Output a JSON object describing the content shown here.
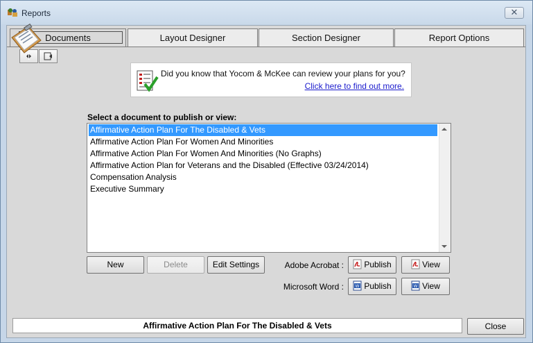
{
  "window": {
    "title": "Reports"
  },
  "tabs": [
    {
      "label": "Documents",
      "active": true
    },
    {
      "label": "Layout Designer",
      "active": false
    },
    {
      "label": "Section Designer",
      "active": false
    },
    {
      "label": "Report Options",
      "active": false
    }
  ],
  "info": {
    "text": "Did you know that Yocom & McKee can review your plans for you?",
    "link": "Click here to find out more."
  },
  "documents": {
    "label": "Select a document to publish or view:",
    "items": [
      "Affirmative Action Plan For The Disabled & Vets",
      "Affirmative Action Plan For Women And Minorities",
      "Affirmative Action Plan For Women And Minorities (No Graphs)",
      "Affirmative Action Plan for Veterans and the Disabled (Effective 03/24/2014)",
      "Compensation Analysis",
      "Executive Summary"
    ],
    "selected_index": 0
  },
  "buttons": {
    "new": "New",
    "delete": "Delete",
    "edit_settings": "Edit Settings",
    "publish": "Publish",
    "view": "View",
    "close": "Close"
  },
  "labels": {
    "adobe": "Adobe Acrobat :",
    "word": "Microsoft Word :"
  },
  "status": "Affirmative Action Plan For The Disabled & Vets",
  "colors": {
    "selection": "#3399ff",
    "link": "#1a1acc"
  }
}
